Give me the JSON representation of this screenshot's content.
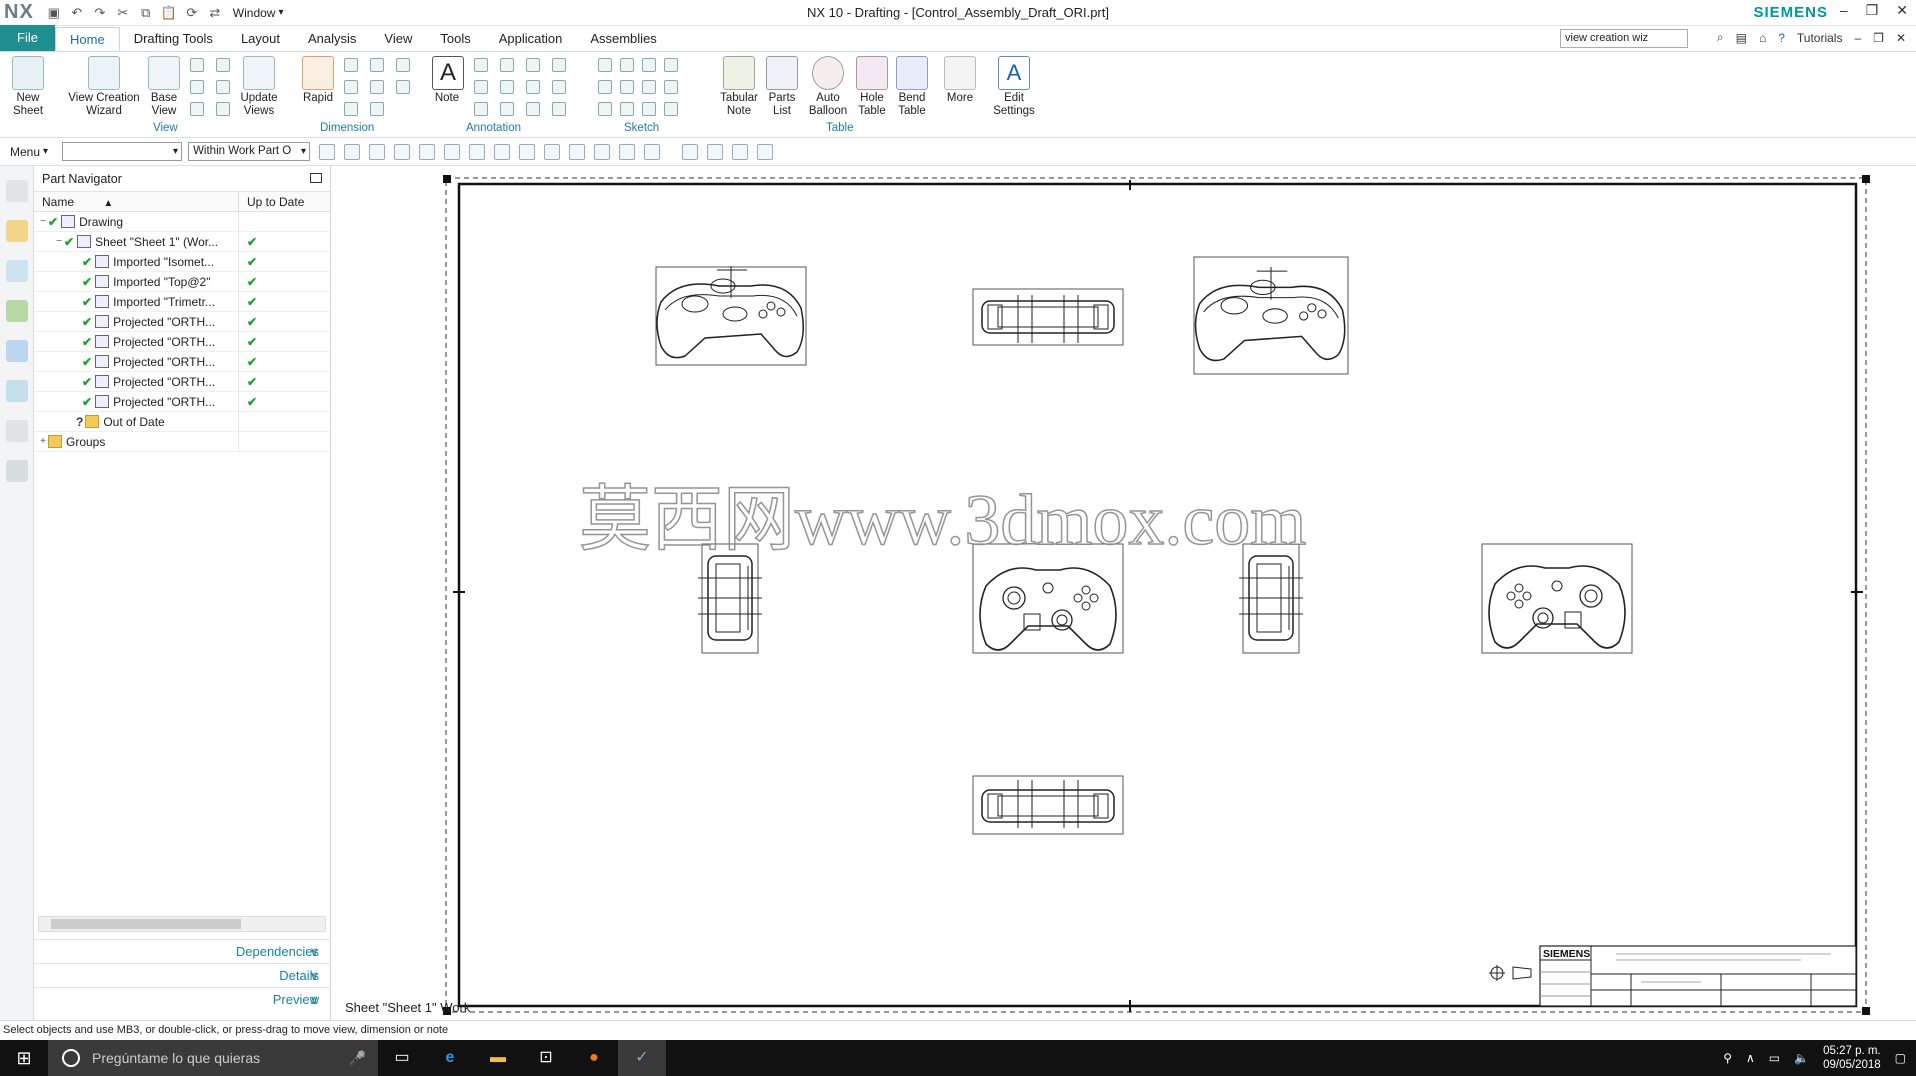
{
  "app": {
    "logo": "NX",
    "window_menu": "Window",
    "title": "NX 10 - Drafting - [Control_Assembly_Draft_ORI.prt]",
    "brand": "SIEMENS"
  },
  "menu": {
    "file": "File",
    "tabs": [
      "Home",
      "Drafting Tools",
      "Layout",
      "Analysis",
      "View",
      "Tools",
      "Application",
      "Assemblies"
    ],
    "search_value": "view creation wiz",
    "tutorials": "Tutorials"
  },
  "ribbon": {
    "new_sheet": "New Sheet",
    "view_creation_wizard": "View Creation Wizard",
    "base_view": "Base View",
    "update_views": "Update Views",
    "rapid": "Rapid",
    "note": "Note",
    "tabular_note": "Tabular Note",
    "parts_list": "Parts List",
    "auto_balloon": "Auto Balloon",
    "hole_table": "Hole Table",
    "bend_table": "Bend Table",
    "more": "More",
    "edit_settings": "Edit Settings",
    "groups": {
      "view": "View",
      "dimension": "Dimension",
      "annotation": "Annotation",
      "sketch": "Sketch",
      "table": "Table"
    }
  },
  "toolbar2": {
    "menu": "Menu",
    "filter_value": "",
    "scope_value": "Within Work Part O"
  },
  "navigator": {
    "title": "Part Navigator",
    "col_name": "Name",
    "col_uptodate": "Up to Date",
    "rows": [
      {
        "label": "Drawing"
      },
      {
        "label": "Sheet \"Sheet 1\" (Wor..."
      },
      {
        "label": "Imported \"Isomet..."
      },
      {
        "label": "Imported \"Top@2\""
      },
      {
        "label": "Imported \"Trimetr..."
      },
      {
        "label": "Projected \"ORTH..."
      },
      {
        "label": "Projected \"ORTH..."
      },
      {
        "label": "Projected \"ORTH..."
      },
      {
        "label": "Projected \"ORTH..."
      },
      {
        "label": "Projected \"ORTH..."
      },
      {
        "label": "Out of Date"
      },
      {
        "label": "Groups"
      }
    ],
    "sections": [
      "Dependencies",
      "Details",
      "Preview"
    ]
  },
  "canvas": {
    "watermark": "莫西网www.3dmox.com",
    "title_block_brand": "SIEMENS",
    "sheet_label": "Sheet \"Sheet 1\" Work"
  },
  "status": "Select objects and use MB3, or double-click, or press-drag to move view, dimension or note",
  "taskbar": {
    "search_placeholder": "Pregúntame lo que quieras",
    "time": "05:27 p. m.",
    "date": "09/05/2018"
  },
  "colors": {
    "accent": "#1f8f8f",
    "check": "#1fa02b",
    "brand": "#009999"
  }
}
